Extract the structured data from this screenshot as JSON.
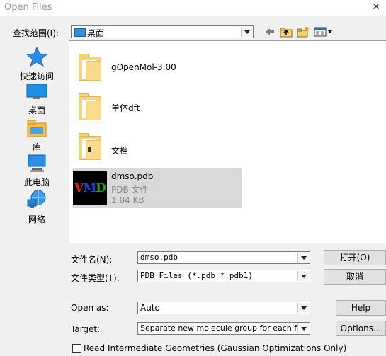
{
  "window": {
    "title": "Open Files",
    "close_glyph": "✕"
  },
  "lookin": {
    "label": "查找范围(I):",
    "value": "桌面"
  },
  "places": [
    {
      "label": "快速访问",
      "icon": "star-icon"
    },
    {
      "label": "桌面",
      "icon": "desktop-icon"
    },
    {
      "label": "库",
      "icon": "library-icon"
    },
    {
      "label": "此电脑",
      "icon": "computer-icon"
    },
    {
      "label": "网络",
      "icon": "network-icon"
    }
  ],
  "files": [
    {
      "name": "gOpenMol-3.00"
    },
    {
      "name": "单体dft"
    },
    {
      "name": "文档"
    },
    {
      "name": "dmso.pdb",
      "type": "PDB 文件",
      "size": "1.04 KB",
      "selected": true
    }
  ],
  "vmd_logo": {
    "v": "V",
    "m": "M",
    "d": "D"
  },
  "filename": {
    "label": "文件名(N):",
    "value": "dmso.pdb"
  },
  "filetype": {
    "label": "文件类型(T):",
    "value": "PDB Files (*.pdb *.pdb1)"
  },
  "open_as": {
    "label": "Open as:",
    "value": "Auto"
  },
  "target": {
    "label": "Target:",
    "value": "Separate new molecule group for each file"
  },
  "buttons": {
    "open": "打开(O)",
    "cancel": "取消",
    "help": "Help",
    "options": "Options..."
  },
  "read_intermediate": {
    "label": "Read Intermediate Geometries (Gaussian Optimizations Only)",
    "checked": false
  }
}
